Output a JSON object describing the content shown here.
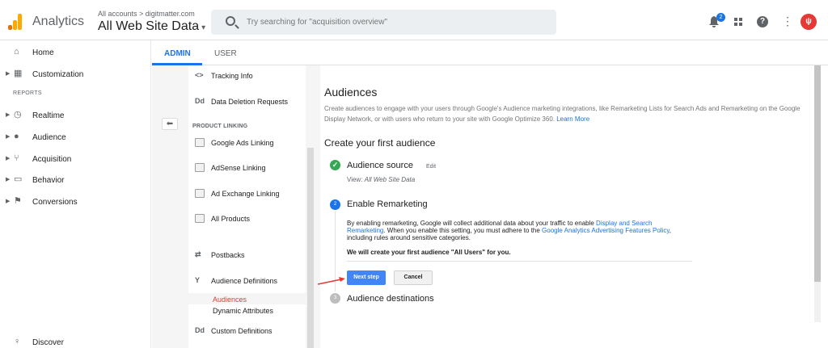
{
  "header": {
    "app_name": "Analytics",
    "breadcrumb": "All accounts > digitmatter.com",
    "view_name": "All Web Site Data",
    "view_caret": "▾",
    "search_placeholder": "Try searching for \"acquisition overview\"",
    "notification_count": "2",
    "help_glyph": "?",
    "more_glyph": "⋮",
    "avatar_letter": "ψ",
    "icons": [
      "search-icon",
      "bell-icon",
      "apps-icon",
      "help-icon",
      "more-icon"
    ]
  },
  "leftnav": {
    "items_top": [
      {
        "label": "Home",
        "icon": "home-icon",
        "glyph": "⌂"
      },
      {
        "label": "Customization",
        "icon": "dashboard-icon",
        "glyph": "▦"
      }
    ],
    "section_label": "REPORTS",
    "items_reports": [
      {
        "label": "Realtime",
        "icon": "clock-icon",
        "glyph": "◷"
      },
      {
        "label": "Audience",
        "icon": "person-icon",
        "glyph": "●"
      },
      {
        "label": "Acquisition",
        "icon": "acquisition-icon",
        "glyph": "⑂"
      },
      {
        "label": "Behavior",
        "icon": "behavior-icon",
        "glyph": "▭"
      },
      {
        "label": "Conversions",
        "icon": "flag-icon",
        "glyph": "⚑"
      }
    ],
    "discover": {
      "label": "Discover",
      "icon": "lightbulb-icon",
      "glyph": "♀"
    }
  },
  "tabs": {
    "admin": "ADMIN",
    "user": "USER"
  },
  "admin": {
    "back_glyph": "⬅",
    "items_top": [
      {
        "label": "Tracking Info",
        "glyph": "<>"
      },
      {
        "label": "Data Deletion Requests",
        "glyph": "Dd"
      }
    ],
    "product_linking_header": "PRODUCT LINKING",
    "items_linking": [
      {
        "label": "Google Ads Linking"
      },
      {
        "label": "AdSense Linking"
      },
      {
        "label": "Ad Exchange Linking"
      },
      {
        "label": "All Products"
      },
      {
        "label": "Postbacks"
      },
      {
        "label": "Audience Definitions"
      }
    ],
    "sub_items": [
      "Audiences",
      "Dynamic Attributes"
    ],
    "custom_definitions": {
      "label": "Custom Definitions",
      "glyph": "Dd"
    }
  },
  "main": {
    "title": "Audiences",
    "description": "Create audiences to engage with your users through Google's Audience marketing integrations, like Remarketing Lists for Search Ads and Remarketing on the Google Display Network, or with users who return to your site with Google Optimize 360. ",
    "learn_more": "Learn More",
    "create_title": "Create your first audience",
    "step1": {
      "number": "✓",
      "title": "Audience source",
      "edit": "Edit",
      "view_label": "View: ",
      "view_value": "All Web Site Data"
    },
    "step2": {
      "number": "2",
      "title": "Enable Remarketing",
      "text_a": "By enabling remarketing, Google will collect additional data about your traffic to enable ",
      "link_a": "Display and Search Remarketing",
      "text_b": ". When you enable this setting, you must adhere to the ",
      "link_b": "Google Analytics Advertising Features Policy",
      "text_c": ", including rules around sensitive categories.",
      "bold": "We will create your first audience \"All Users\" for you.",
      "next_button": "Next step",
      "cancel_button": "Cancel"
    },
    "step3": {
      "number": "3",
      "title": "Audience destinations"
    }
  },
  "colors": {
    "accent": "#1a73e8",
    "annotation_arrow": "#e53935",
    "success": "#34a853"
  }
}
